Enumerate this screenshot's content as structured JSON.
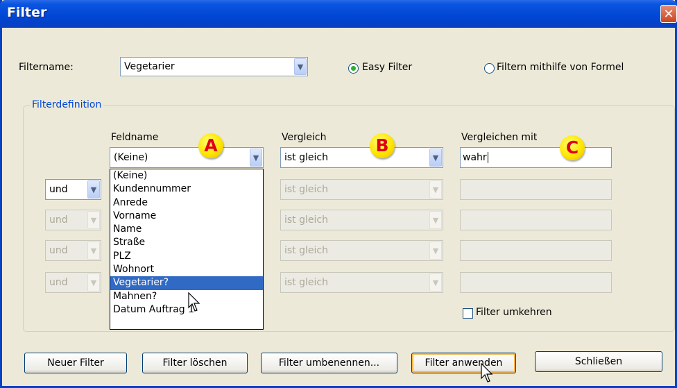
{
  "window": {
    "title": "Filter",
    "close_glyph": "✕"
  },
  "filtername": {
    "label": "Filtername:",
    "value": "Vegetarier"
  },
  "modes": {
    "easy": "Easy Filter",
    "formula": "Filtern mithilfe von Formel",
    "selected": "easy"
  },
  "group": {
    "legend": "Filterdefinition"
  },
  "columns": {
    "field": "Feldname",
    "compare": "Vergleich",
    "value": "Vergleichen mit"
  },
  "markers": {
    "a": "A",
    "b": "B",
    "c": "C"
  },
  "rows": [
    {
      "logic": "",
      "field": "(Keine)",
      "compare": "ist gleich",
      "value": "wahr",
      "enabled": true
    },
    {
      "logic": "und",
      "field": "",
      "compare": "ist gleich",
      "value": "",
      "enabled": false
    },
    {
      "logic": "und",
      "field": "",
      "compare": "ist gleich",
      "value": "",
      "enabled": false
    },
    {
      "logic": "und",
      "field": "",
      "compare": "ist gleich",
      "value": "",
      "enabled": false
    },
    {
      "logic": "und",
      "field": "",
      "compare": "ist gleich",
      "value": "",
      "enabled": false
    }
  ],
  "field_options": [
    "(Keine)",
    "Kundennummer",
    "Anrede",
    "Vorname",
    "Name",
    "Straße",
    "PLZ",
    "Wohnort",
    "Vegetarier?",
    "Mahnen?",
    "Datum Auftrag 1"
  ],
  "highlighted_option": "Vegetarier?",
  "invert": {
    "label": "Filter umkehren",
    "checked": false
  },
  "buttons": {
    "new": "Neuer Filter",
    "delete": "Filter löschen",
    "rename": "Filter umbenennen...",
    "apply": "Filter anwenden",
    "close": "Schließen"
  },
  "icons": {
    "dropdown_arrow": "chevron-down-icon",
    "cursor": "mouse-pointer-icon"
  },
  "colors": {
    "titlebar": "#0046d5",
    "selection": "#316ac5",
    "marker_fill": "#ffe500",
    "marker_text": "#e0001b"
  }
}
